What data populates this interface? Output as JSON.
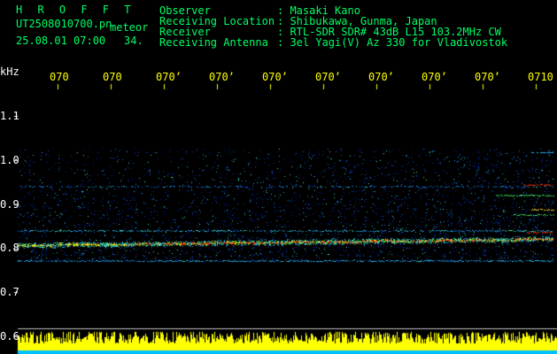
{
  "header": {
    "brand": "H R O F F T",
    "filename": "UT2508010700.pn",
    "mode": "meteor",
    "datetime": "25.08.01 07:00",
    "count": "34."
  },
  "info": {
    "observer_label": "Observer",
    "observer_value": ": Masaki Kano",
    "location_label": "Receiving Location",
    "location_value": ": Shibukawa, Gunma, Japan",
    "receiver_label": "Receiver",
    "receiver_value": ": RTL-SDR SDR# 43dB L15 103.2MHz CW",
    "antenna_label": "Receiving Antenna",
    "antenna_value": ": 3el Yagi(V) Az 330 for Vladivostok"
  },
  "axis": {
    "unit": "kHz",
    "y_ticks": [
      "1.1",
      "1.0",
      "0.9",
      "0.8",
      "0.7",
      "0.6"
    ],
    "time_ticks": [
      "070",
      "070",
      "070’",
      "070’",
      "070’",
      "070’",
      "070’",
      "070’",
      "070’",
      "0710"
    ]
  },
  "colors": {
    "text": "#00ff66",
    "ticks": "#ffff00",
    "signal_low": "#0033cc",
    "signal_high": "#ff2200",
    "activity_bar": "#ffff00"
  }
}
